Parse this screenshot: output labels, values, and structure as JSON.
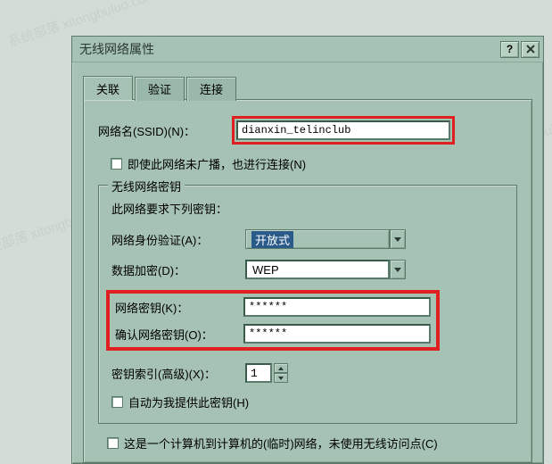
{
  "title": "无线网络属性",
  "tabs": {
    "assoc": "关联",
    "auth": "验证",
    "conn": "连接"
  },
  "ssid": {
    "label": "网络名(SSID)(N)：",
    "label_alt": "网络名(SSID)(N)：",
    "value": "dianxin_telinclub",
    "broadcast_chk": "即使此网络未广播，也进行连接(N)"
  },
  "key_group": {
    "legend": "无线网络密钥",
    "note": "此网络要求下列密钥：",
    "auth": {
      "label": "网络身份验证(A)：",
      "value": "开放式"
    },
    "enc": {
      "label": "数据加密(D)：",
      "value": "WEP"
    },
    "key": {
      "label": "网络密钥(K)：",
      "value": "******"
    },
    "key2": {
      "label": "确认网络密钥(O)：",
      "value": "******"
    },
    "index": {
      "label": "密钥索引(高级)(X)：",
      "value": "1"
    },
    "auto": "自动为我提供此密钥(H)"
  },
  "adhoc": "这是一个计算机到计算机的(临时)网络，未使用无线访问点(C)"
}
